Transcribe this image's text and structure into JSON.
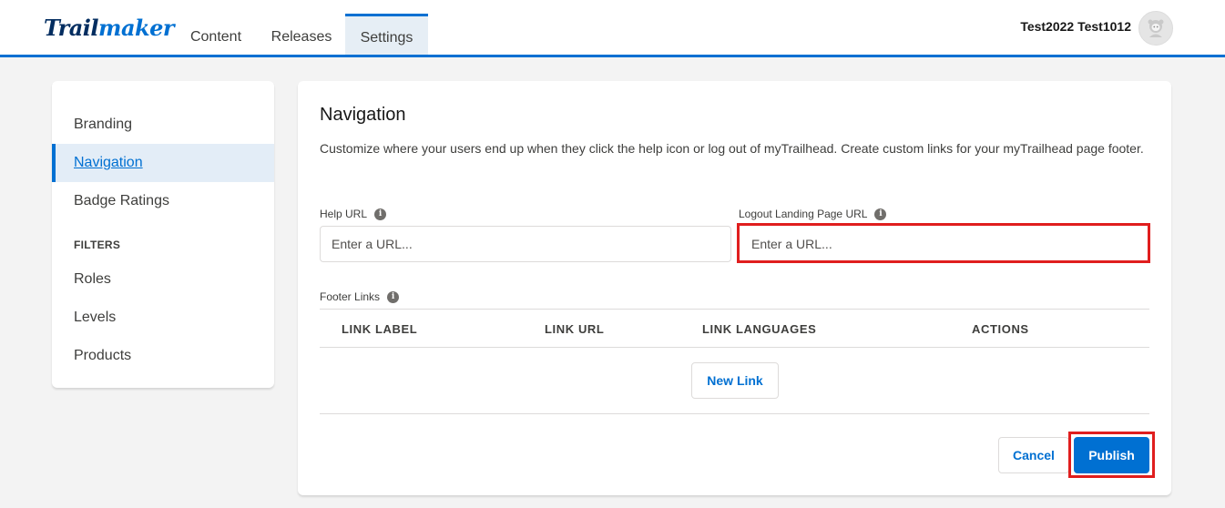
{
  "header": {
    "logo_part1": "Trail",
    "logo_part2": "maker",
    "tabs": [
      {
        "label": "Content"
      },
      {
        "label": "Releases"
      },
      {
        "label": "Settings"
      }
    ],
    "user_name": "Test2022 Test1012"
  },
  "sidebar": {
    "items": [
      {
        "label": "Branding"
      },
      {
        "label": "Navigation"
      },
      {
        "label": "Badge Ratings"
      }
    ],
    "filters_heading": "FILTERS",
    "filters": [
      {
        "label": "Roles"
      },
      {
        "label": "Levels"
      },
      {
        "label": "Products"
      }
    ]
  },
  "main": {
    "title": "Navigation",
    "description": "Customize where your users end up when they click the help icon or log out of myTrailhead. Create custom links for your myTrailhead page footer.",
    "help_url": {
      "label": "Help URL",
      "placeholder": "Enter a URL...",
      "value": ""
    },
    "logout_url": {
      "label": "Logout Landing Page URL",
      "placeholder": "Enter a URL...",
      "value": ""
    },
    "footer_links_label": "Footer Links",
    "table_headers": [
      "LINK LABEL",
      "LINK URL",
      "LINK LANGUAGES",
      "ACTIONS"
    ],
    "new_link_label": "New Link",
    "cancel_label": "Cancel",
    "publish_label": "Publish"
  },
  "colors": {
    "accent": "#0070d2",
    "highlight": "#e01e1e",
    "logo_dark": "#032d60"
  }
}
